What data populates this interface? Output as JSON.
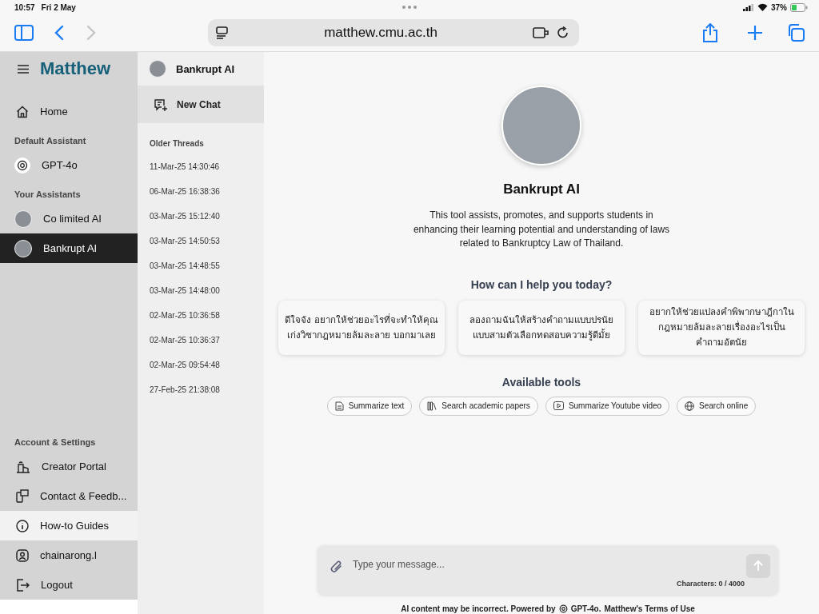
{
  "status_bar": {
    "time": "10:57",
    "date": "Fri 2 May",
    "battery": "37%"
  },
  "browser": {
    "url": "matthew.cmu.ac.th"
  },
  "sidebar": {
    "logo": "Matthew",
    "sections": [
      {
        "items": [
          {
            "label": "Home",
            "kind": "home",
            "selected": false,
            "hovered": false
          }
        ]
      },
      {
        "heading": "Default Assistant",
        "items": [
          {
            "label": "GPT-4o",
            "kind": "gpt",
            "selected": false,
            "hovered": false
          }
        ]
      },
      {
        "heading": "Your Assistants",
        "items": [
          {
            "label": "Co limited AI",
            "kind": "avatar",
            "selected": false,
            "hovered": false
          },
          {
            "label": "Bankrupt AI",
            "kind": "avatar",
            "selected": true,
            "hovered": false
          }
        ]
      }
    ],
    "bottom": {
      "heading": "Account & Settings",
      "items": [
        {
          "label": "Creator Portal",
          "kind": "portal",
          "selected": false,
          "hovered": false
        },
        {
          "label": "Contact & Feedb...",
          "kind": "contact",
          "selected": false,
          "hovered": false
        },
        {
          "label": "How-to Guides",
          "kind": "info",
          "selected": false,
          "hovered": true
        },
        {
          "label": "chainarong.l",
          "kind": "user",
          "selected": false,
          "hovered": false
        },
        {
          "label": "Logout",
          "kind": "logout",
          "selected": false,
          "hovered": false
        }
      ]
    }
  },
  "threads": {
    "assistant": "Bankrupt AI",
    "new_chat": "New Chat",
    "heading": "Older Threads",
    "items": [
      "11-Mar-25 14:30:46",
      "06-Mar-25 16:38:36",
      "03-Mar-25 15:12:40",
      "03-Mar-25 14:50:53",
      "03-Mar-25 14:48:55",
      "03-Mar-25 14:48:00",
      "02-Mar-25 10:36:58",
      "02-Mar-25 10:36:37",
      "02-Mar-25 09:54:48",
      "27-Feb-25 21:38:08"
    ]
  },
  "main": {
    "title": "Bankrupt AI",
    "description": "This tool assists, promotes, and supports students in enhancing their learning potential and understanding of laws related to Bankruptcy Law of Thailand.",
    "prompt_heading": "How can I help you today?",
    "suggestions": [
      "ดีใจจัง อยากให้ช่วยอะไรที่จะทำให้คุณเก่งวิชากฎหมายล้มละลาย บอกมาเลย",
      "ลองถามฉันให้สร้างคำถามแบบปรนัยแบบสามตัวเลือกทดสอบความรู้ดีมั้ย",
      "อยากให้ช่วยแปลงคำพิพากษาฎีกาในกฎหมายล้มละลายเรื่องอะไรเป็นคำถามอัตนัย"
    ],
    "tools_heading": "Available tools",
    "tools": [
      {
        "label": "Summarize text",
        "kind": "doc"
      },
      {
        "label": "Search academic papers",
        "kind": "books"
      },
      {
        "label": "Summarize Youtube video",
        "kind": "video"
      },
      {
        "label": "Search online",
        "kind": "globe"
      }
    ],
    "input": {
      "placeholder": "Type your message...",
      "counter": "Characters: 0 / 4000"
    },
    "footer": {
      "before": "AI content may be incorrect. Powered by",
      "model": "GPT-4o.",
      "after": "Matthew's Terms of Use"
    }
  }
}
